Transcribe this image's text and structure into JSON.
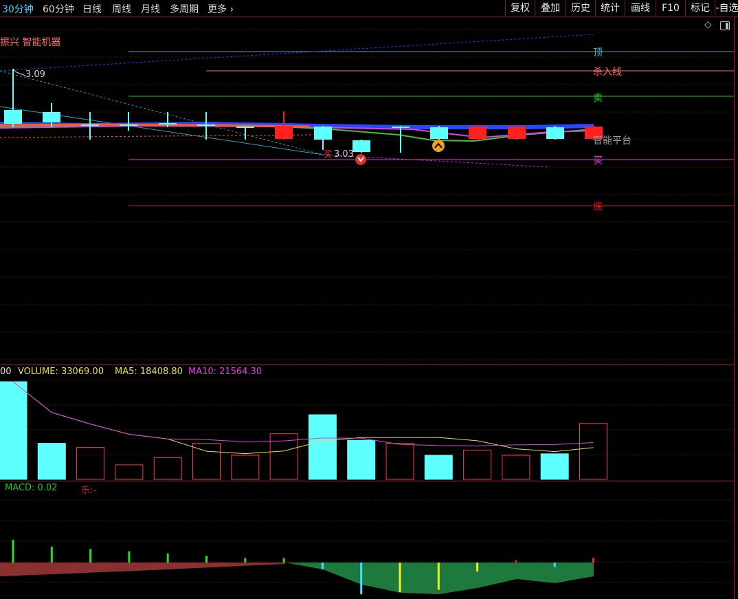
{
  "toolbar": {
    "tabs": [
      "30分钟",
      "60分钟",
      "日线",
      "周线",
      "月线",
      "多周期",
      "更多"
    ],
    "more_arrow": "›",
    "right_buttons": [
      "复权",
      "叠加",
      "历史",
      "统计",
      "画线",
      "F10",
      "标记",
      "-自选"
    ]
  },
  "main": {
    "title": "振兴 智能机器",
    "price_high": "3.09",
    "price_low": "3.03",
    "buy_mark": "买",
    "levels": [
      {
        "label": "顶",
        "color": "#26b7c9"
      },
      {
        "label": "杀入线",
        "color": "#ff6b6b"
      },
      {
        "label": "卖",
        "color": "#1ec81e"
      },
      {
        "label": "智能平台",
        "color": "#9a9a9a"
      },
      {
        "label": "买",
        "color": "#e03ae0"
      },
      {
        "label": "底",
        "color": "#e01414"
      }
    ]
  },
  "volume": {
    "prefix": "00",
    "volume_label": "VOLUME: 33069.00",
    "ma5_label": "MA5: 18408.80",
    "ma10_label": "MA10: 21564.30",
    "colors": {
      "up": "#ff3b3b",
      "down": "#5effff",
      "ma5": "#e8e04a",
      "ma10": "#e040e0"
    }
  },
  "macd": {
    "label": "MACD: 0.02",
    "extra_label": "乐:-"
  },
  "icons": [
    "diamond-icon",
    "window-toggle-icon",
    "sell-signal-icon",
    "buy-signal-icon"
  ],
  "chart_data": [
    {
      "type": "bar",
      "title": "VOLUME",
      "categories": [
        "1",
        "2",
        "3",
        "4",
        "5",
        "6",
        "7",
        "8",
        "9",
        "10",
        "11",
        "12",
        "13",
        "14",
        "15",
        "16"
      ],
      "series": [
        {
          "name": "VOLUME",
          "values": [
            39000,
            14400,
            12800,
            5800,
            8700,
            14400,
            9600,
            18200,
            25800,
            15600,
            14400,
            9600,
            11700,
            9600,
            10200,
            22300
          ]
        }
      ],
      "bar_colors": [
        "down",
        "down",
        "up",
        "up",
        "up",
        "up",
        "up",
        "up",
        "down",
        "down",
        "up",
        "down",
        "up",
        "up",
        "down",
        "up"
      ]
    },
    {
      "type": "bar",
      "title": "MACD",
      "categories": [
        "1",
        "2",
        "3",
        "4",
        "5",
        "6",
        "7",
        "8",
        "9",
        "10",
        "11",
        "12",
        "13",
        "14",
        "15",
        "16"
      ],
      "series": [
        {
          "name": "MACD",
          "values": [
            0.1,
            0.07,
            0.06,
            0.05,
            0.04,
            0.03,
            0.02,
            0.02,
            -0.03,
            -0.14,
            -0.13,
            -0.12,
            -0.04,
            0.01,
            -0.02,
            0.02
          ]
        }
      ]
    }
  ]
}
